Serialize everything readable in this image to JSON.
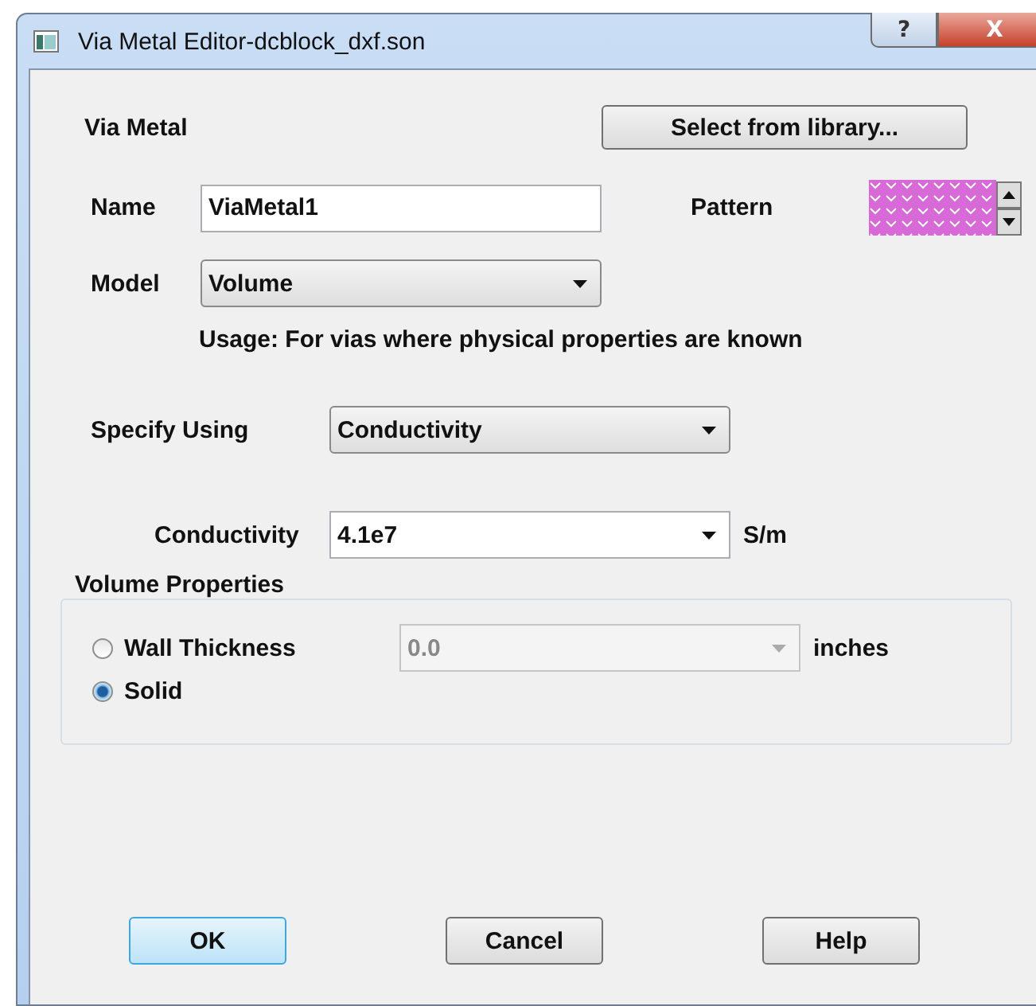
{
  "window": {
    "title": "Via Metal Editor-dcblock_dxf.son",
    "title_buttons": [
      {
        "label": "?",
        "kind": "help"
      },
      {
        "label": "X",
        "kind": "close"
      }
    ]
  },
  "heading": "Via Metal",
  "library_button": "Select from library...",
  "name": {
    "label": "Name",
    "value": "ViaMetal1"
  },
  "pattern": {
    "label": "Pattern"
  },
  "model": {
    "label": "Model",
    "value": "Volume",
    "note": "Usage: For vias where physical properties are known"
  },
  "specify_using": {
    "label": "Specify Using",
    "value": "Conductivity"
  },
  "conductivity": {
    "label": "Conductivity",
    "value": "4.1e7",
    "unit": "S/m"
  },
  "volume_properties": {
    "title": "Volume Properties",
    "options": [
      {
        "label": "Wall Thickness",
        "selected": false
      },
      {
        "label": "Solid",
        "selected": true
      }
    ],
    "wall_thickness": {
      "value": "0.0",
      "unit": "inches",
      "disabled": true
    }
  },
  "buttons": [
    {
      "label": "OK",
      "default": true
    },
    {
      "label": "Cancel",
      "default": false
    },
    {
      "label": "Help",
      "default": false
    }
  ]
}
